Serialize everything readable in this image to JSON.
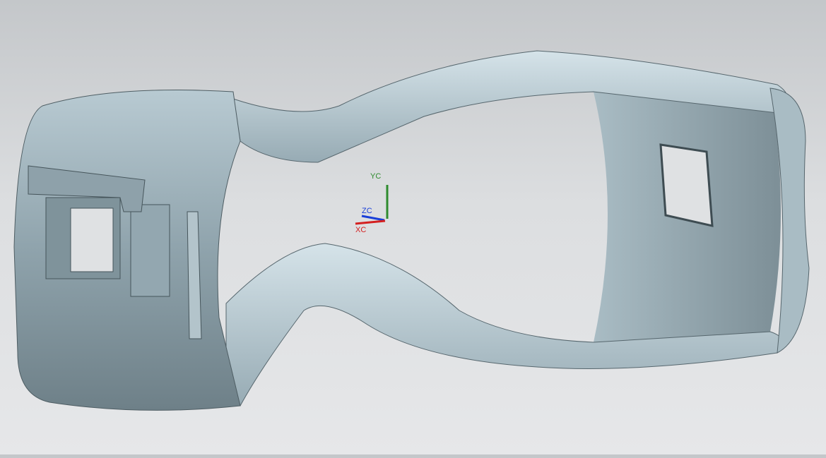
{
  "viewport": {
    "triad": {
      "y_label": "YC",
      "z_label": "ZC",
      "x_label": "XC",
      "colors": {
        "x": "#d42020",
        "y": "#2e8b2e",
        "z": "#1a3fd8"
      }
    },
    "model_color": "#9fb2bb"
  }
}
